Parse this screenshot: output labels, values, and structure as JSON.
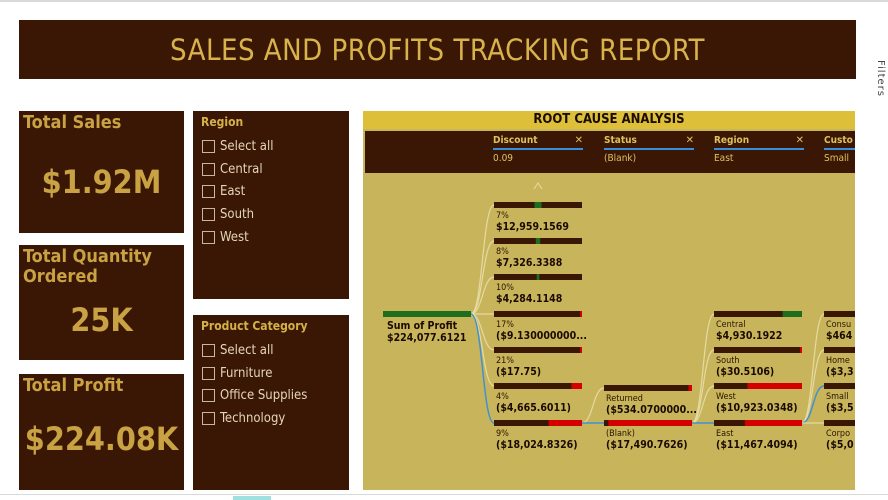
{
  "header": {
    "title": "SALES AND PROFITS TRACKING REPORT"
  },
  "side_text": "Filters",
  "kpis": {
    "total_sales": {
      "label": "Total Sales",
      "value": "$1.92M"
    },
    "total_quantity": {
      "label": "Total Quantity Ordered",
      "value": "25K"
    },
    "total_profit": {
      "label": "Total Profit",
      "value": "$224.08K"
    }
  },
  "region_slicer": {
    "title": "Region",
    "items": [
      "Select all",
      "Central",
      "East",
      "South",
      "West"
    ]
  },
  "category_slicer": {
    "title": "Product Category",
    "items": [
      "Select all",
      "Furniture",
      "Office Supplies",
      "Technology"
    ]
  },
  "rca": {
    "title": "ROOT CAUSE ANALYSIS",
    "columns": [
      {
        "name": "Discount",
        "value": "0.09"
      },
      {
        "name": "Status",
        "value": "(Blank)"
      },
      {
        "name": "Region",
        "value": "East"
      },
      {
        "name": "Custo",
        "value": "Small"
      }
    ],
    "root": {
      "label": "Sum of Profit",
      "value": "$224,077.6121"
    },
    "discount_nodes": [
      {
        "label": "7%",
        "value": "$12,959.1569",
        "color": "#1e6e1e",
        "fill": 0.08
      },
      {
        "label": "8%",
        "value": "$7,326.3388",
        "color": "#1e6e1e",
        "fill": 0.05
      },
      {
        "label": "10%",
        "value": "$4,284.1148",
        "color": "#1e6e1e",
        "fill": 0.03
      },
      {
        "label": "17%",
        "value": "($9.130000000...",
        "color": "#d40000",
        "fill": 0.01
      },
      {
        "label": "21%",
        "value": "($17.75)",
        "color": "#d40000",
        "fill": 0.01
      },
      {
        "label": "4%",
        "value": "($4,665.6011)",
        "color": "#d40000",
        "fill": 0.12
      },
      {
        "label": "9%",
        "value": "($18,024.8326)",
        "color": "#d40000",
        "fill": 0.38,
        "selected": true
      }
    ],
    "status_nodes": [
      {
        "label": "Returned",
        "value": "($534.0700000...",
        "color": "#d40000",
        "fill": 0.04
      },
      {
        "label": "(Blank)",
        "value": "($17,490.7626)",
        "color": "#d40000",
        "fill": 0.95,
        "selected": true
      }
    ],
    "region_nodes": [
      {
        "label": "Central",
        "value": "$4,930.1922",
        "color": "#1e6e1e",
        "fill": 0.22
      },
      {
        "label": "South",
        "value": "($30.5106)",
        "color": "#d40000",
        "fill": 0.01
      },
      {
        "label": "West",
        "value": "($10,923.0348)",
        "color": "#d40000",
        "fill": 0.62
      },
      {
        "label": "East",
        "value": "($11,467.4094)",
        "color": "#d40000",
        "fill": 0.65,
        "selected": true
      }
    ],
    "customer_nodes": [
      {
        "label": "Consu",
        "value": "$464",
        "color": "#d40000",
        "fill": 0.0
      },
      {
        "label": "Home",
        "value": "($3,3",
        "color": "#d40000",
        "fill": 0.3
      },
      {
        "label": "Small",
        "value": "($3,5",
        "color": "#d40000",
        "fill": 0.5,
        "selected": true
      },
      {
        "label": "Corpo",
        "value": "($5,0",
        "color": "#d40000",
        "fill": 0.6
      }
    ]
  },
  "colors": {
    "brand_dark": "#3a1704",
    "gold": "#c9a243",
    "canvas": "#c8b55b",
    "positive": "#1e6e1e",
    "negative": "#d40000"
  }
}
